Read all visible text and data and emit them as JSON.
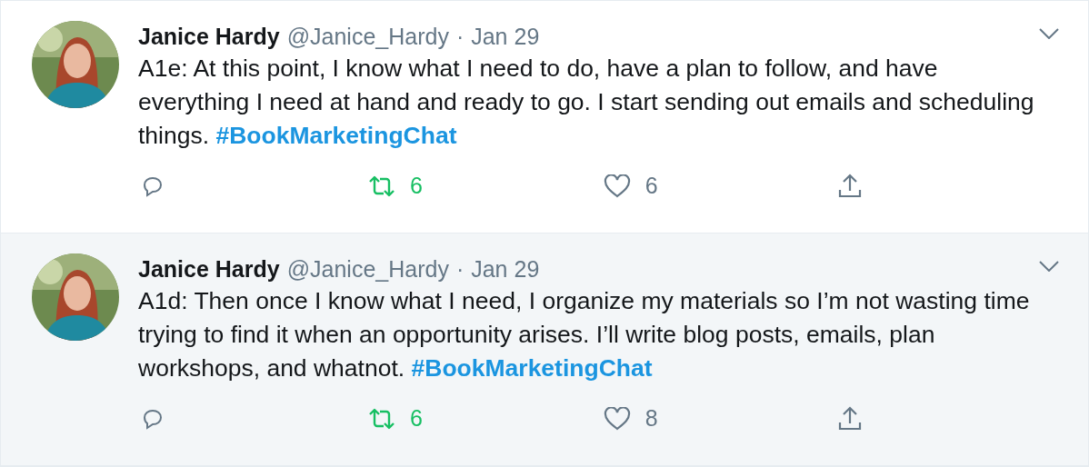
{
  "tweets": [
    {
      "name": "Janice Hardy",
      "handle": "@Janice_Hardy",
      "separator": "·",
      "date": "Jan 29",
      "text": "A1e: At this point, I know what I need to do, have a plan to follow, and have everything I need at hand and ready to go. I start sending out emails and scheduling things. ",
      "hashtag": "#BookMarketingChat",
      "retweets": "6",
      "retweeted": true,
      "likes": "6",
      "liked": false,
      "highlighted": false
    },
    {
      "name": "Janice Hardy",
      "handle": "@Janice_Hardy",
      "separator": "·",
      "date": "Jan 29",
      "text": "A1d: Then once I know what I need, I organize my materials so I’m not wasting time trying to find it when an opportunity arises. I’ll write blog posts, emails, plan workshops, and whatnot. ",
      "hashtag": "#BookMarketingChat",
      "retweets": "6",
      "retweeted": true,
      "likes": "8",
      "liked": false,
      "highlighted": true
    }
  ]
}
